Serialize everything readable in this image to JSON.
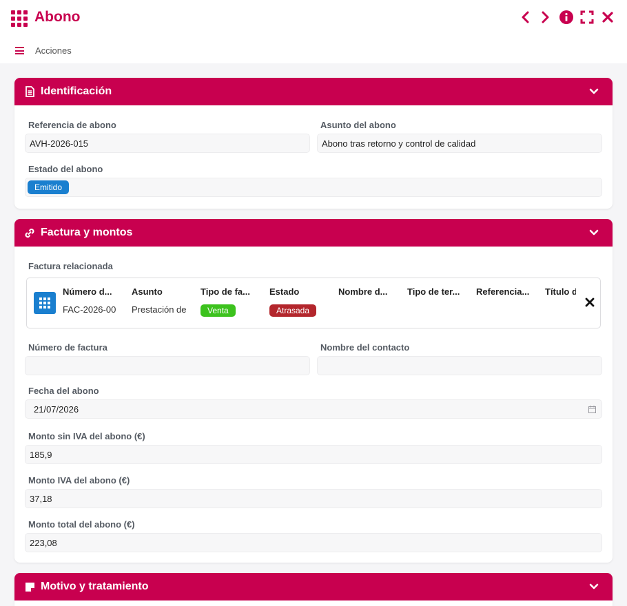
{
  "window": {
    "title": "Abono",
    "actions_label": "Acciones"
  },
  "icons": {
    "app": "grid-icon",
    "prev": "chevron-left-icon",
    "next": "chevron-right-icon",
    "info": "info-icon",
    "fullscreen": "fullscreen-icon",
    "close": "close-icon",
    "menu": "hamburger-icon"
  },
  "colors": {
    "brand": "#c8004f",
    "status_blue": "#1a7fcf",
    "venta_green": "#3cc21d",
    "atrasada_red": "#b3262c"
  },
  "identificacion": {
    "title": "Identificación",
    "referencia_label": "Referencia de abono",
    "referencia_value": "AVH-2026-015",
    "asunto_label": "Asunto del abono",
    "asunto_value": "Abono tras retorno y control de calidad",
    "estado_label": "Estado del abono",
    "estado_value": "Emitido"
  },
  "factura": {
    "title": "Factura y montos",
    "relacionada_label": "Factura relacionada",
    "columns": [
      {
        "header": "Número d...",
        "value": "FAC-2026-00"
      },
      {
        "header": "Asunto",
        "value": "Prestación de"
      },
      {
        "header": "Tipo de fa...",
        "value": "Venta"
      },
      {
        "header": "Estado",
        "value": "Atrasada"
      },
      {
        "header": "Nombre d...",
        "value": ""
      },
      {
        "header": "Tipo de ter...",
        "value": ""
      },
      {
        "header": "Referencia...",
        "value": ""
      },
      {
        "header": "Título d",
        "value": ""
      }
    ],
    "numero_label": "Número de factura",
    "numero_value": "",
    "contacto_label": "Nombre del contacto",
    "contacto_value": "",
    "fecha_label": "Fecha del abono",
    "fecha_value": "21/07/2026",
    "monto_sin_iva_label": "Monto sin IVA del abono (€)",
    "monto_sin_iva_value": "185,9",
    "monto_iva_label": "Monto IVA del abono (€)",
    "monto_iva_value": "37,18",
    "monto_total_label": "Monto total del abono (€)",
    "monto_total_value": "223,08"
  },
  "motivo": {
    "title": "Motivo y tratamiento"
  }
}
